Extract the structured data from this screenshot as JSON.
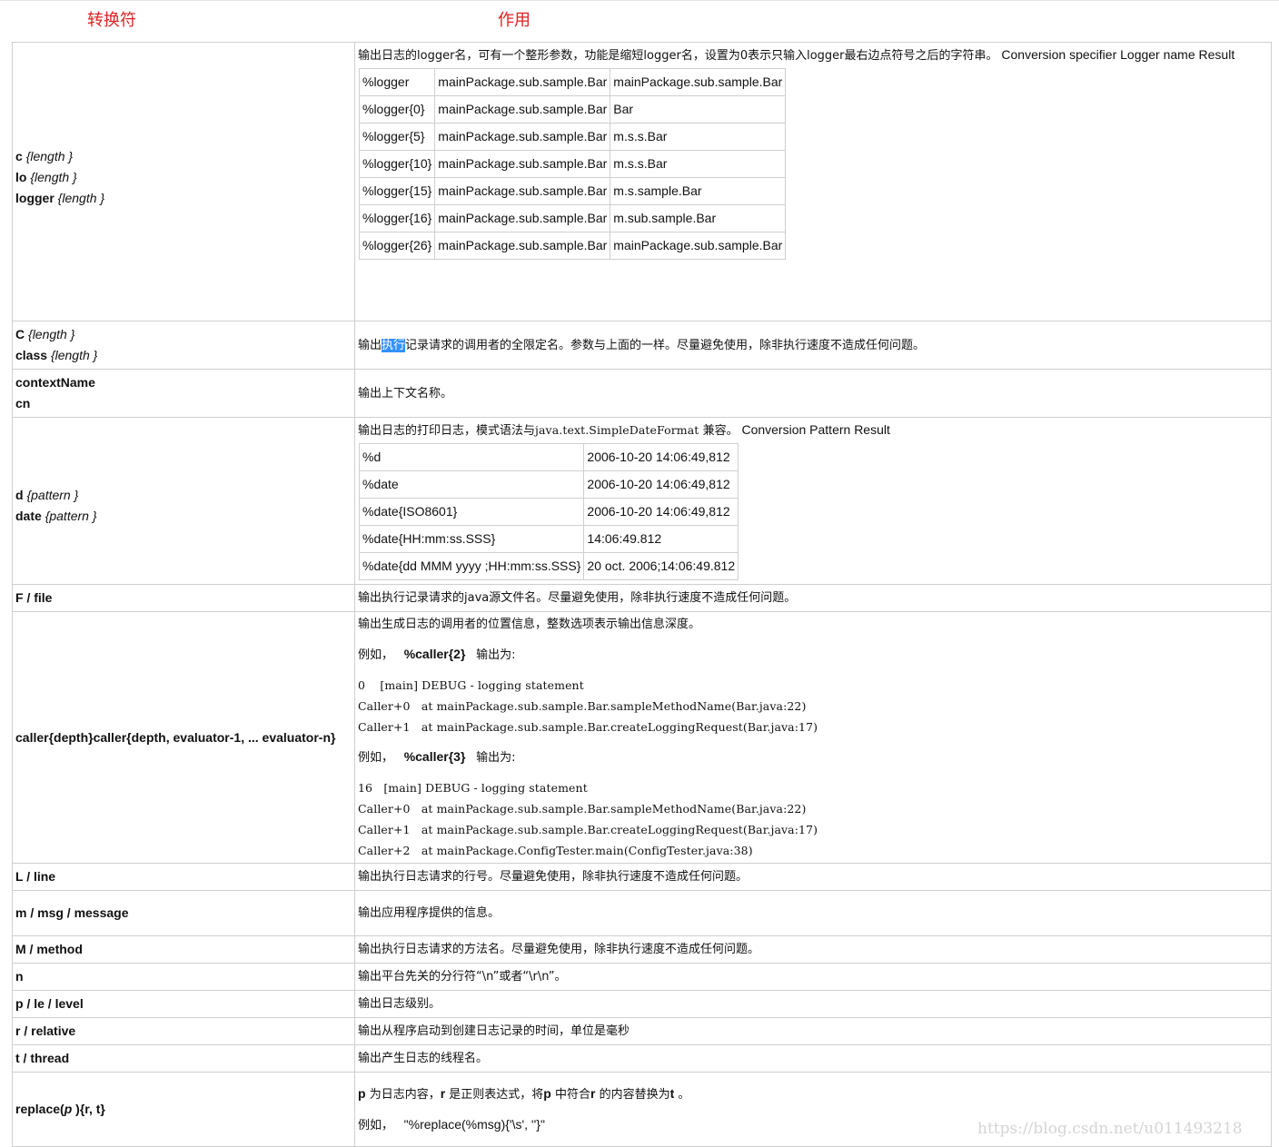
{
  "headers": {
    "col1": "转换符",
    "col2": "作用"
  },
  "logger": {
    "keys": [
      {
        "name": "c",
        "arg": "{length }"
      },
      {
        "name": "lo",
        "arg": "{length }"
      },
      {
        "name": "logger",
        "arg": "{length }"
      }
    ],
    "desc_zh": "输出日志的logger名，可有一个整形参数，功能是缩短logger名，设置为0表示只输入logger最右边点符号之后的字符串。",
    "desc_en": " Conversion specifier Logger name Result",
    "rows": [
      [
        "%logger",
        "mainPackage.sub.sample.Bar",
        "mainPackage.sub.sample.Bar"
      ],
      [
        "%logger{0}",
        "mainPackage.sub.sample.Bar",
        "Bar"
      ],
      [
        "%logger{5}",
        "mainPackage.sub.sample.Bar",
        "m.s.s.Bar"
      ],
      [
        "%logger{10}",
        "mainPackage.sub.sample.Bar",
        "m.s.s.Bar"
      ],
      [
        "%logger{15}",
        "mainPackage.sub.sample.Bar",
        "m.s.sample.Bar"
      ],
      [
        "%logger{16}",
        "mainPackage.sub.sample.Bar",
        "m.sub.sample.Bar"
      ],
      [
        "%logger{26}",
        "mainPackage.sub.sample.Bar",
        "mainPackage.sub.sample.Bar"
      ]
    ]
  },
  "class_row": {
    "keys": [
      {
        "name": "C",
        "arg": "{length }"
      },
      {
        "name": "class",
        "arg": "{length }"
      }
    ],
    "desc_pre": "输出",
    "desc_hl": "执行",
    "desc_post": "记录请求的调用者的全限定名。参数与上面的一样。尽量避免使用，除非执行速度不造成任何问题。"
  },
  "context_row": {
    "keys": [
      "contextName",
      "cn"
    ],
    "desc": "输出上下文名称。"
  },
  "date_row": {
    "keys": [
      {
        "name": "d",
        "arg": "{pattern }"
      },
      {
        "name": "date",
        "arg": "{pattern }"
      }
    ],
    "desc_zh": "输出日志的打印日志，模式语法与",
    "desc_code": "java.text.SimpleDateFormat",
    "desc_zh2": " 兼容。",
    "desc_en": "  Conversion Pattern Result",
    "rows": [
      [
        "%d",
        "2006-10-20 14:06:49,812"
      ],
      [
        "%date",
        "2006-10-20 14:06:49,812"
      ],
      [
        "%date{ISO8601}",
        "2006-10-20 14:06:49,812"
      ],
      [
        "%date{HH:mm:ss.SSS}",
        "14:06:49.812"
      ],
      [
        "%date{dd MMM yyyy ;HH:mm:ss.SSS}",
        "20 oct. 2006;14:06:49.812"
      ]
    ]
  },
  "file_row": {
    "key": "F / file",
    "desc": "输出执行记录请求的java源文件名。尽量避免使用，除非执行速度不造成任何问题。"
  },
  "caller_row": {
    "key": "caller{depth}caller{depth, evaluator-1, ... evaluator-n}",
    "desc": "输出生成日志的调用者的位置信息，整数选项表示输出信息深度。",
    "ex1_pre": "例如，",
    "ex1_code": "%caller{2}",
    "ex1_post": "输出为:",
    "ex1_lines": [
      "0    [main] DEBUG - logging statement",
      "Caller+0   at mainPackage.sub.sample.Bar.sampleMethodName(Bar.java:22)",
      "Caller+1   at mainPackage.sub.sample.Bar.createLoggingRequest(Bar.java:17)"
    ],
    "ex2_pre": "例如，",
    "ex2_code": "%caller{3}",
    "ex2_post": "输出为:",
    "ex2_lines": [
      "16   [main] DEBUG - logging statement",
      "Caller+0   at mainPackage.sub.sample.Bar.sampleMethodName(Bar.java:22)",
      "Caller+1   at mainPackage.sub.sample.Bar.createLoggingRequest(Bar.java:17)",
      "Caller+2   at mainPackage.ConfigTester.main(ConfigTester.java:38)"
    ]
  },
  "simple_rows": [
    {
      "key": "L / line",
      "desc": "输出执行日志请求的行号。尽量避免使用，除非执行速度不造成任何问题。",
      "h": 30
    },
    {
      "key": "m / msg / message",
      "desc": "输出应用程序提供的信息。",
      "h": 50
    },
    {
      "key": "M / method",
      "desc": "输出执行日志请求的方法名。尽量避免使用，除非执行速度不造成任何问题。",
      "h": 30
    },
    {
      "key": "n",
      "desc": "输出平台先关的分行符“\\n”或者“\\r\\n”。",
      "h": 30
    },
    {
      "key": "p / le / level",
      "desc": "输出日志级别。",
      "h": 30
    },
    {
      "key": "r / relative",
      "desc": "输出从程序启动到创建日志记录的时间，单位是毫秒",
      "h": 30
    },
    {
      "key": "t / thread",
      "desc": "输出产生日志的线程名。",
      "h": 30
    }
  ],
  "replace_row": {
    "key_pre": "replace(",
    "key_p": "p",
    "key_post": " ){r, t}",
    "d_p": "p",
    "d_1": " 为日志内容，",
    "d_r": "r",
    "d_2": " 是正则表达式，将",
    "d_p2": "p",
    "d_3": " 中符合",
    "d_r2": "r",
    "d_4": " 的内容替换为",
    "d_t": "t",
    "d_5": " 。",
    "ex_pre": "例如，",
    "ex_code": " \"%replace(%msg){'\\s', ''}\""
  },
  "watermark": "https://blog.csdn.net/u011493218"
}
